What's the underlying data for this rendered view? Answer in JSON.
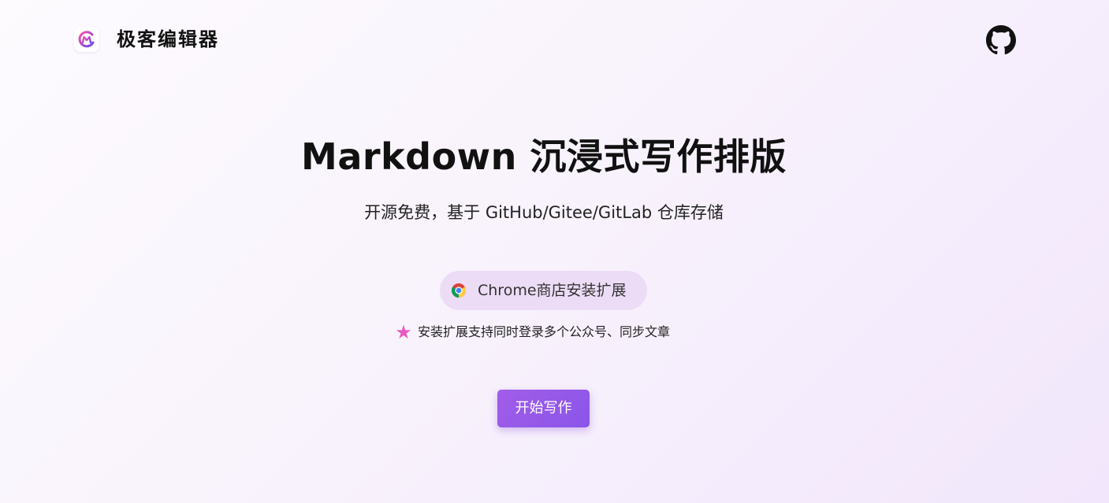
{
  "brand": {
    "name": "极客编辑器",
    "logo_icon": "geek-editor-logo-icon",
    "accent": "#9b5de5"
  },
  "header": {
    "github_icon": "github-icon"
  },
  "hero": {
    "title": "Markdown 沉浸式写作排版",
    "subtitle": "开源免费，基于 GitHub/Gitee/GitLab 仓库存储"
  },
  "extension": {
    "button_label": "Chrome商店安装扩展",
    "icon": "chrome-icon",
    "note": "安装扩展支持同时登录多个公众号、同步文章",
    "note_icon": "star-icon"
  },
  "cta": {
    "start_label": "开始写作",
    "color": "#9a58e8"
  }
}
